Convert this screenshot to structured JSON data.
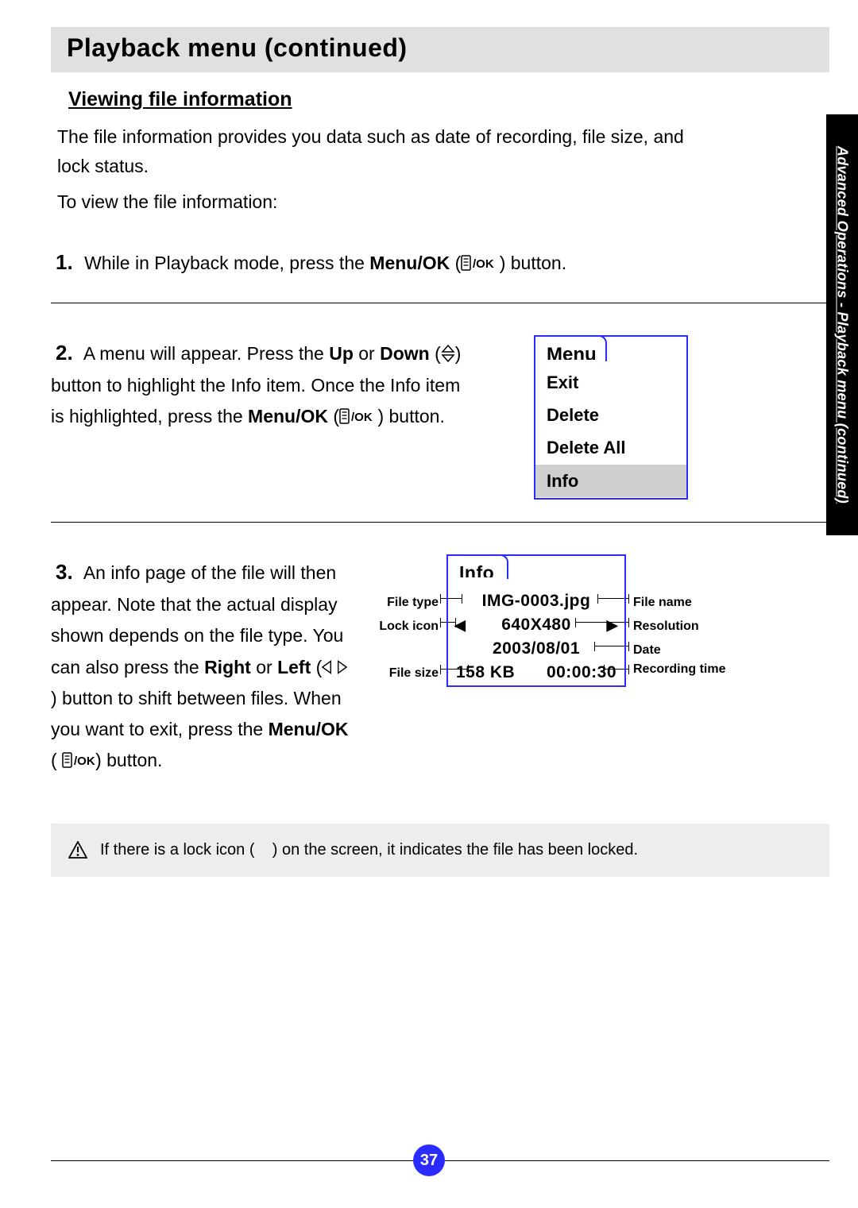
{
  "page": {
    "title": "Playback menu (continued)",
    "subheading": "Viewing file information",
    "intro1": "The file information provides you data such as date of recording, file size, and lock status.",
    "intro2": "To view the file information:",
    "sidebar": "Advanced Operations - Playback menu (continued)",
    "number": "37"
  },
  "steps": {
    "s1": {
      "num": "1.",
      "a": "While in Playback mode, press the ",
      "b": "Menu/OK",
      "c": " (",
      "d": " ) button."
    },
    "s2": {
      "num": "2.",
      "a": "A menu will appear. Press the ",
      "b": "Up",
      "c": " or ",
      "d": "Down",
      "e": " (",
      "f": ") button to highlight the Info item. Once the Info item is highlighted, press the ",
      "g": "Menu/OK",
      "h": " (",
      "i": " ) button."
    },
    "s3": {
      "num": "3.",
      "a": "An info page of the file will then appear. Note that the actual display shown depends on the file type. You can also press the ",
      "b": "Right",
      "c": " or ",
      "d": "Left",
      "e": " (",
      "f": ") button to shift between files. When you want to exit, press the ",
      "g": "Menu/OK",
      "h": " ( ",
      "i": ") button."
    }
  },
  "menu": {
    "tab": "Menu",
    "items": [
      "Exit",
      "Delete",
      "Delete All",
      "Info"
    ],
    "highlighted_index": 3
  },
  "info": {
    "tab": "Info",
    "file_name": "IMG-0003.jpg",
    "resolution": "640X480",
    "date": "2003/08/01",
    "file_size": "158 KB",
    "rec_time": "00:00:30",
    "labels": {
      "file_type": "File type",
      "lock_icon": "Lock icon",
      "file_size": "File size",
      "file_name": "File name",
      "resolution": "Resolution",
      "date": "Date",
      "rec_time": "Recording time"
    }
  },
  "note": {
    "a": "If there is a lock icon (",
    "b": ") on the screen, it indicates the file has been locked."
  },
  "icons": {
    "menuok": "menu-ok-icon",
    "updown": "up-down-icon",
    "leftright": "left-right-icon",
    "warn": "warning-icon",
    "tri_left": "◀",
    "tri_right": "▶"
  }
}
